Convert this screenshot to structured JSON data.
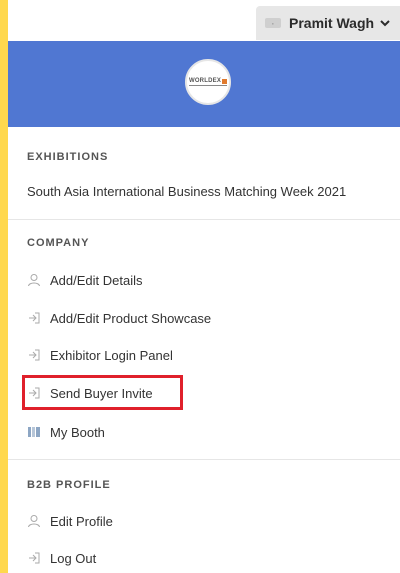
{
  "user": {
    "name": "Pramit Wagh",
    "avatar_icon": "company-logo-thumbnail"
  },
  "banner": {
    "logo_text": "WORLDEX",
    "color": "#5077d2"
  },
  "exhibitions": {
    "header": "EXHIBITIONS",
    "item": "South Asia International Business Matching Week 2021"
  },
  "company": {
    "header": "COMPANY",
    "items": [
      {
        "label": "Add/Edit Details",
        "icon": "user-icon"
      },
      {
        "label": "Add/Edit Product Showcase",
        "icon": "sign-in-icon"
      },
      {
        "label": "Exhibitor Login Panel",
        "icon": "sign-in-icon"
      },
      {
        "label": "Send Buyer Invite",
        "icon": "sign-in-icon"
      },
      {
        "label": "My Booth",
        "icon": "booth-icon"
      }
    ]
  },
  "b2b": {
    "header": "B2B PROFILE",
    "items": [
      {
        "label": "Edit Profile",
        "icon": "user-icon"
      },
      {
        "label": "Log Out",
        "icon": "sign-in-icon"
      }
    ]
  },
  "colors": {
    "background": "#ffd84d",
    "highlight": "#e0202b"
  }
}
